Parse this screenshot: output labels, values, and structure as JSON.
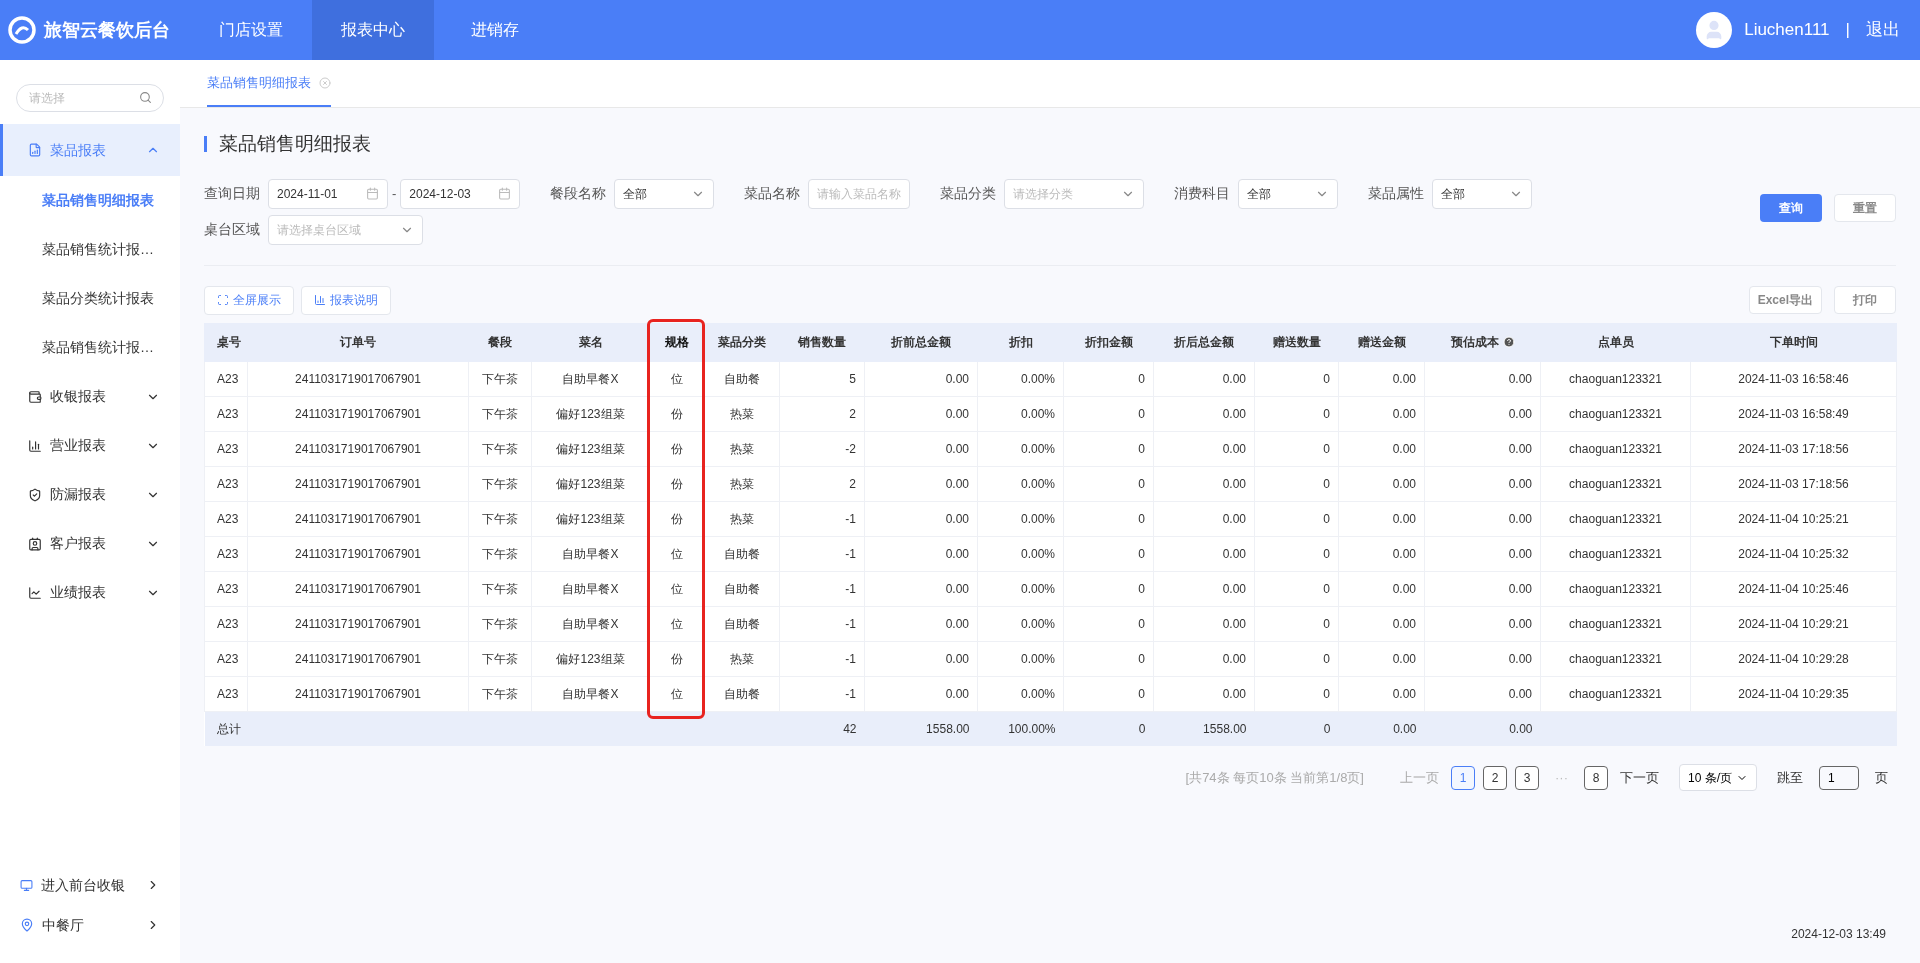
{
  "header": {
    "brand": "旅智云餐饮后台",
    "nav": [
      {
        "label": "门店设置",
        "selected": false
      },
      {
        "label": "报表中心",
        "selected": true
      },
      {
        "label": "进销存",
        "selected": false
      }
    ],
    "user": "Liuchen111",
    "separator": "|",
    "logout": "退出"
  },
  "sidebar": {
    "search": {
      "placeholder": "请选择"
    },
    "groups": [
      {
        "label": "菜品报表",
        "expanded": true,
        "selected": true,
        "children": [
          {
            "label": "菜品销售明细报表",
            "selected": true
          },
          {
            "label": "菜品销售统计报…",
            "selected": false
          },
          {
            "label": "菜品分类统计报表",
            "selected": false
          },
          {
            "label": "菜品销售统计报…",
            "selected": false
          }
        ]
      },
      {
        "label": "收银报表",
        "expanded": false,
        "selected": false
      },
      {
        "label": "营业报表",
        "expanded": false,
        "selected": false
      },
      {
        "label": "防漏报表",
        "expanded": false,
        "selected": false
      },
      {
        "label": "客户报表",
        "expanded": false,
        "selected": false
      },
      {
        "label": "业绩报表",
        "expanded": false,
        "selected": false
      }
    ],
    "footer": [
      {
        "kind": "monitor",
        "label": "进入前台收银"
      },
      {
        "kind": "pin",
        "label": "中餐厅"
      }
    ]
  },
  "tabs": [
    {
      "label": "菜品销售明细报表",
      "selected": true
    }
  ],
  "page_title": "菜品销售明细报表",
  "filters": [
    {
      "kind": "date_range",
      "label": "查询日期",
      "from": "2024-11-01",
      "dash": "-",
      "to": "2024-12-03"
    },
    {
      "kind": "select",
      "label": "餐段名称",
      "value": "全部"
    },
    {
      "kind": "input",
      "label": "菜品名称",
      "placeholder": "请输入菜品名称"
    },
    {
      "kind": "select",
      "label": "菜品分类",
      "placeholder": "请选择分类"
    },
    {
      "kind": "select",
      "label": "消费科目",
      "value": "全部"
    },
    {
      "kind": "select",
      "label": "菜品属性",
      "value": "全部"
    },
    {
      "kind": "select",
      "label": "桌台区域",
      "placeholder": "请选择桌台区域"
    }
  ],
  "query_button": "查询",
  "reset_button": "重置",
  "left_tools": [
    {
      "kind": "fullscreen",
      "label": "全屏展示"
    },
    {
      "kind": "chart",
      "label": "报表说明"
    }
  ],
  "right_tools": [
    "Excel导出",
    "打印"
  ],
  "table": {
    "columns": [
      {
        "label": "桌号",
        "kind": "key",
        "highlighted": false
      },
      {
        "label": "订单号",
        "kind": "text",
        "highlighted": false
      },
      {
        "label": "餐段",
        "kind": "text",
        "highlighted": false
      },
      {
        "label": "菜名",
        "kind": "text",
        "highlighted": false
      },
      {
        "label": "规格",
        "kind": "text",
        "highlighted": true
      },
      {
        "label": "菜品分类",
        "kind": "text",
        "highlighted": false
      },
      {
        "label": "销售数量",
        "kind": "number",
        "highlighted": false
      },
      {
        "label": "折前总金额",
        "kind": "number",
        "highlighted": false
      },
      {
        "label": "折扣",
        "kind": "number",
        "highlighted": false
      },
      {
        "label": "折扣金额",
        "kind": "number",
        "highlighted": false
      },
      {
        "label": "折后总金额",
        "kind": "number",
        "highlighted": false
      },
      {
        "label": "赠送数量",
        "kind": "number",
        "highlighted": false
      },
      {
        "label": "赠送金额",
        "kind": "number",
        "highlighted": false
      },
      {
        "label": "预估成本",
        "kind": "number",
        "highlighted": false,
        "help": true
      },
      {
        "label": "点单员",
        "kind": "text",
        "highlighted": false
      },
      {
        "label": "下单时间",
        "kind": "text",
        "highlighted": false
      }
    ],
    "rows": [
      [
        "A23",
        "2411031719017067901",
        "下午茶",
        "自助早餐X",
        "位",
        "自助餐",
        "5",
        "0.00",
        "0.00%",
        "0",
        "0.00",
        "0",
        "0.00",
        "0.00",
        "chaoguan123321",
        "2024-11-03 16:58:46"
      ],
      [
        "A23",
        "2411031719017067901",
        "下午茶",
        "偏好123组菜",
        "份",
        "热菜",
        "2",
        "0.00",
        "0.00%",
        "0",
        "0.00",
        "0",
        "0.00",
        "0.00",
        "chaoguan123321",
        "2024-11-03 16:58:49"
      ],
      [
        "A23",
        "2411031719017067901",
        "下午茶",
        "偏好123组菜",
        "份",
        "热菜",
        "-2",
        "0.00",
        "0.00%",
        "0",
        "0.00",
        "0",
        "0.00",
        "0.00",
        "chaoguan123321",
        "2024-11-03 17:18:56"
      ],
      [
        "A23",
        "2411031719017067901",
        "下午茶",
        "偏好123组菜",
        "份",
        "热菜",
        "2",
        "0.00",
        "0.00%",
        "0",
        "0.00",
        "0",
        "0.00",
        "0.00",
        "chaoguan123321",
        "2024-11-03 17:18:56"
      ],
      [
        "A23",
        "2411031719017067901",
        "下午茶",
        "偏好123组菜",
        "份",
        "热菜",
        "-1",
        "0.00",
        "0.00%",
        "0",
        "0.00",
        "0",
        "0.00",
        "0.00",
        "chaoguan123321",
        "2024-11-04 10:25:21"
      ],
      [
        "A23",
        "2411031719017067901",
        "下午茶",
        "自助早餐X",
        "位",
        "自助餐",
        "-1",
        "0.00",
        "0.00%",
        "0",
        "0.00",
        "0",
        "0.00",
        "0.00",
        "chaoguan123321",
        "2024-11-04 10:25:32"
      ],
      [
        "A23",
        "2411031719017067901",
        "下午茶",
        "自助早餐X",
        "位",
        "自助餐",
        "-1",
        "0.00",
        "0.00%",
        "0",
        "0.00",
        "0",
        "0.00",
        "0.00",
        "chaoguan123321",
        "2024-11-04 10:25:46"
      ],
      [
        "A23",
        "2411031719017067901",
        "下午茶",
        "自助早餐X",
        "位",
        "自助餐",
        "-1",
        "0.00",
        "0.00%",
        "0",
        "0.00",
        "0",
        "0.00",
        "0.00",
        "chaoguan123321",
        "2024-11-04 10:29:21"
      ],
      [
        "A23",
        "2411031719017067901",
        "下午茶",
        "偏好123组菜",
        "份",
        "热菜",
        "-1",
        "0.00",
        "0.00%",
        "0",
        "0.00",
        "0",
        "0.00",
        "0.00",
        "chaoguan123321",
        "2024-11-04 10:29:28"
      ],
      [
        "A23",
        "2411031719017067901",
        "下午茶",
        "自助早餐X",
        "位",
        "自助餐",
        "-1",
        "0.00",
        "0.00%",
        "0",
        "0.00",
        "0",
        "0.00",
        "0.00",
        "chaoguan123321",
        "2024-11-04 10:29:35"
      ]
    ],
    "total": [
      {
        "kind": "label",
        "text": "总计"
      },
      {
        "kind": "blank"
      },
      {
        "kind": "blank"
      },
      {
        "kind": "blank"
      },
      {
        "kind": "blank"
      },
      {
        "kind": "blank"
      },
      {
        "kind": "value",
        "text": "42"
      },
      {
        "kind": "value",
        "text": "1558.00"
      },
      {
        "kind": "value",
        "text": "100.00%"
      },
      {
        "kind": "value",
        "text": "0"
      },
      {
        "kind": "value",
        "text": "1558.00"
      },
      {
        "kind": "value",
        "text": "0"
      },
      {
        "kind": "value",
        "text": "0.00"
      },
      {
        "kind": "value",
        "text": "0.00"
      },
      {
        "kind": "blank"
      },
      {
        "kind": "blank"
      }
    ]
  },
  "pagination": {
    "summary": "[共74条 每页10条 当前第1/8页]",
    "prev": "上一页",
    "pages": [
      {
        "kind": "page",
        "label": "1",
        "selected": true
      },
      {
        "kind": "page",
        "label": "2",
        "selected": false
      },
      {
        "kind": "page",
        "label": "3",
        "selected": false
      },
      {
        "kind": "ellipsis",
        "label": "···"
      },
      {
        "kind": "page",
        "label": "8",
        "selected": false
      }
    ],
    "next": "下一页",
    "page_size": "10 条/页",
    "jump_label": "跳至",
    "jump_value": "1",
    "page_unit": "页"
  },
  "timestamp": "2024-12-03 13:49"
}
